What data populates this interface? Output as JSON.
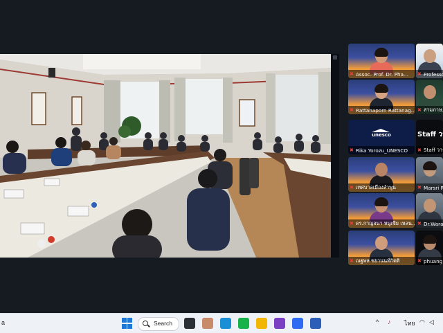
{
  "shared_screen": {
    "label": "shared-screen"
  },
  "participants": [
    {
      "name": "Assoc. Prof. Dr. Pha...",
      "muted": true,
      "bg": "orange",
      "skin": "#d09a78",
      "shirt": "#e86b5a",
      "hair": true
    },
    {
      "name": "Professo...",
      "muted": true,
      "bg": "room",
      "skin": "#caa081",
      "shirt": "#3a4150",
      "hair": false,
      "active": true
    },
    {
      "name": "Rattanaporn Rattanag...",
      "muted": true,
      "bg": "orange",
      "skin": "#d6a382",
      "shirt": "#1f2530",
      "hair": true
    },
    {
      "name": "สามภาษ...",
      "muted": true,
      "bg": "green",
      "skin": "#c08f70",
      "shirt": "#2d4a3a",
      "hair": false
    },
    {
      "name": "Rika Yorozu_UNESCO",
      "muted": true,
      "bg": "dark",
      "logo": "unesco"
    },
    {
      "name": "Staff วาร...",
      "muted": true,
      "bg": "black",
      "staff_title": "Staff วาร"
    },
    {
      "name": "เทศบาลเมืองลำพูน",
      "muted": true,
      "bg": "orange",
      "skin": "#b98465",
      "shirt": "#1b1b1f",
      "hair": false
    },
    {
      "name": "Marsri R...",
      "muted": true,
      "bg": "grey",
      "skin": "#c49a7c",
      "shirt": "#5a6470",
      "hair": true
    },
    {
      "name": "ดร.กาญจนา หนูเขีย เหลน...",
      "muted": true,
      "bg": "orange",
      "skin": "#c89272",
      "shirt": "#7a3a8a",
      "hair": true
    },
    {
      "name": "Dr.Wara...",
      "muted": true,
      "bg": "grey",
      "skin": "#c29575",
      "shirt": "#2f3642",
      "hair": false
    },
    {
      "name": "ณฐพล ชยานนท์กิตติ",
      "muted": true,
      "bg": "orange",
      "skin": "#cf9c7c",
      "shirt": "#26303e",
      "hair": false
    },
    {
      "name": "phuang...",
      "muted": true,
      "bg": "black",
      "skin": "#b88a6c",
      "shirt": "#343a46",
      "hair": true
    }
  ],
  "taskbar": {
    "left_text": "a",
    "search_label": "Search",
    "apps": [
      {
        "name": "task-view",
        "color": "#2b2f36"
      },
      {
        "name": "photos",
        "color": "#c98a6a"
      },
      {
        "name": "edge",
        "color": "#1a8fd6"
      },
      {
        "name": "line",
        "color": "#17b34a"
      },
      {
        "name": "file-explorer",
        "color": "#f2b705"
      },
      {
        "name": "onenote",
        "color": "#7b3fc4"
      },
      {
        "name": "zoom",
        "color": "#2d6cf2"
      },
      {
        "name": "word",
        "color": "#2b5fb8"
      }
    ],
    "tray": {
      "chevron": "^",
      "lang": "ไทย"
    }
  }
}
